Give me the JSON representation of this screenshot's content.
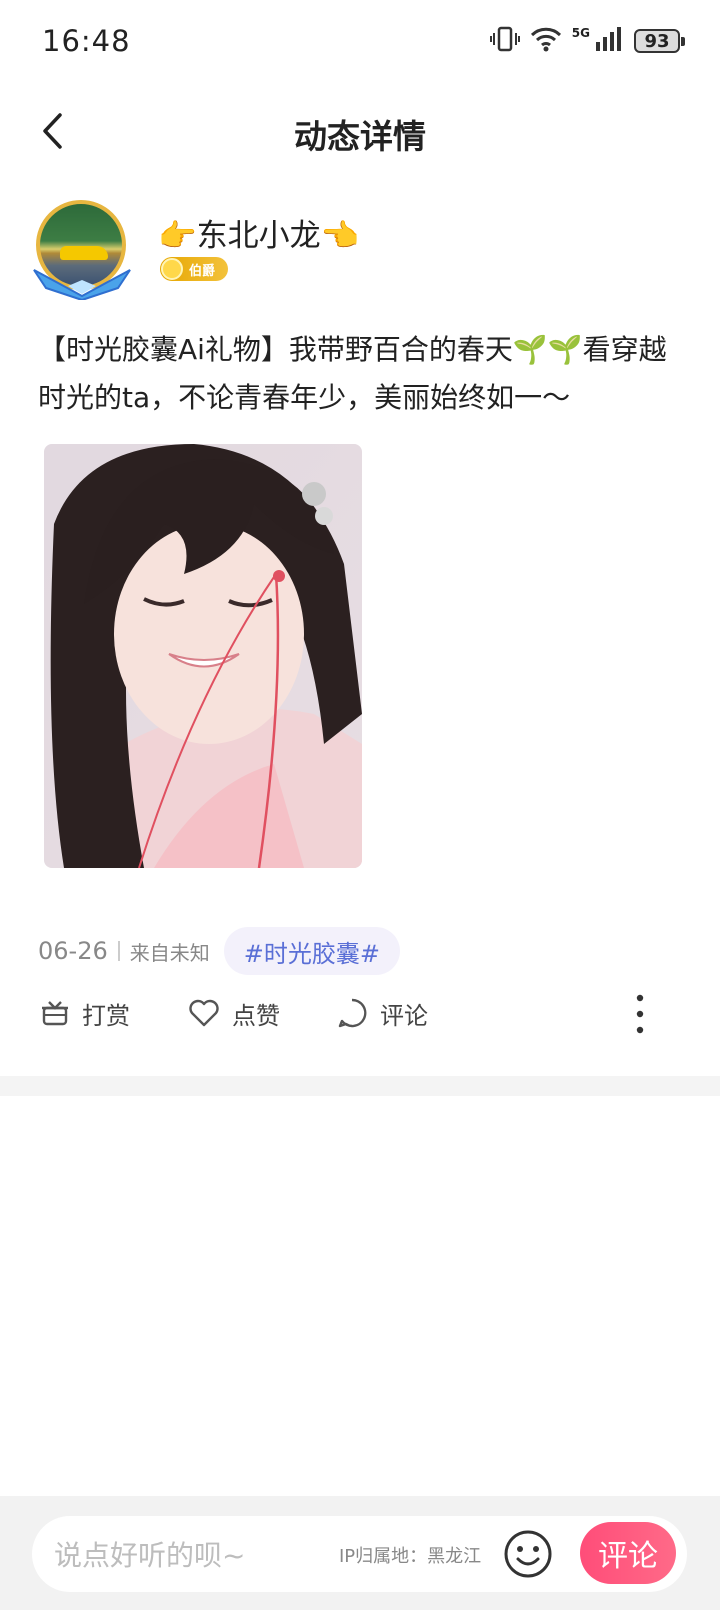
{
  "status_bar": {
    "time": "16:48",
    "network": "5G",
    "battery": "93"
  },
  "nav": {
    "title": "动态详情",
    "back_icon": "chevron-left-icon"
  },
  "author": {
    "name": "👉东北小龙👈",
    "level": "伯爵"
  },
  "post": {
    "text": "【时光胶囊Ai礼物】我带野百合的春天🌱🌱看穿越时光的ta，不论青春年少，美丽始终如一～",
    "date": "06-26",
    "source": "来自未知",
    "topic": "#时光胶囊#"
  },
  "actions": {
    "reward": "打赏",
    "like": "点赞",
    "comment": "评论"
  },
  "comment_bar": {
    "placeholder": "说点好听的呗~",
    "ip_location": "IP归属地：黑龙江",
    "send_label": "评论"
  },
  "colors": {
    "accent_pink": "#ff5a80",
    "topic_blue": "#5a6fd6",
    "badge_gold": "#e6a600"
  }
}
